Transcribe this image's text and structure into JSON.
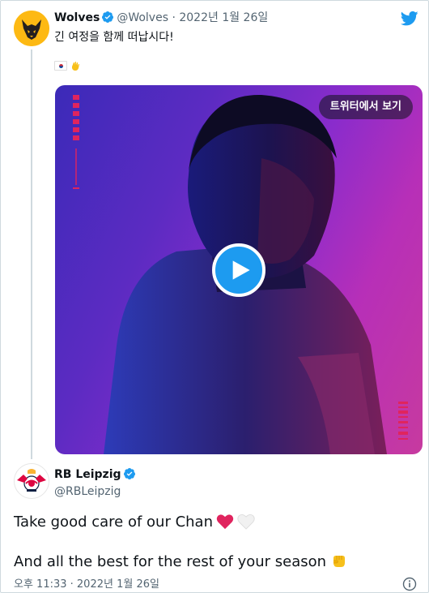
{
  "quoted": {
    "name": "Wolves",
    "handle": "@Wolves",
    "separator": "·",
    "date": "2022년 1월 26일",
    "text": "긴 여정을 함께 떠납시다!",
    "emoji": [
      "flag-south-korea",
      "waving-hand"
    ],
    "media": {
      "view_label": "트위터에서 보기",
      "play_icon": "play-icon"
    }
  },
  "main": {
    "name": "RB Leipzig",
    "handle": "@RBLeipzig",
    "line1": "Take good care of our Chan",
    "line2": "And all the best for the rest of your season",
    "timestamp": "오후 11:33 · 2022년 1월 26일"
  },
  "colors": {
    "accent": "#1d9bf0",
    "wolves_gold": "#fdb913",
    "text_secondary": "#536471",
    "heart_red": "#e0245e"
  },
  "icons": [
    "twitter-bird-icon",
    "verified-badge-icon",
    "play-icon",
    "info-icon",
    "red-heart-icon",
    "white-heart-icon",
    "fist-bump-icon"
  ]
}
